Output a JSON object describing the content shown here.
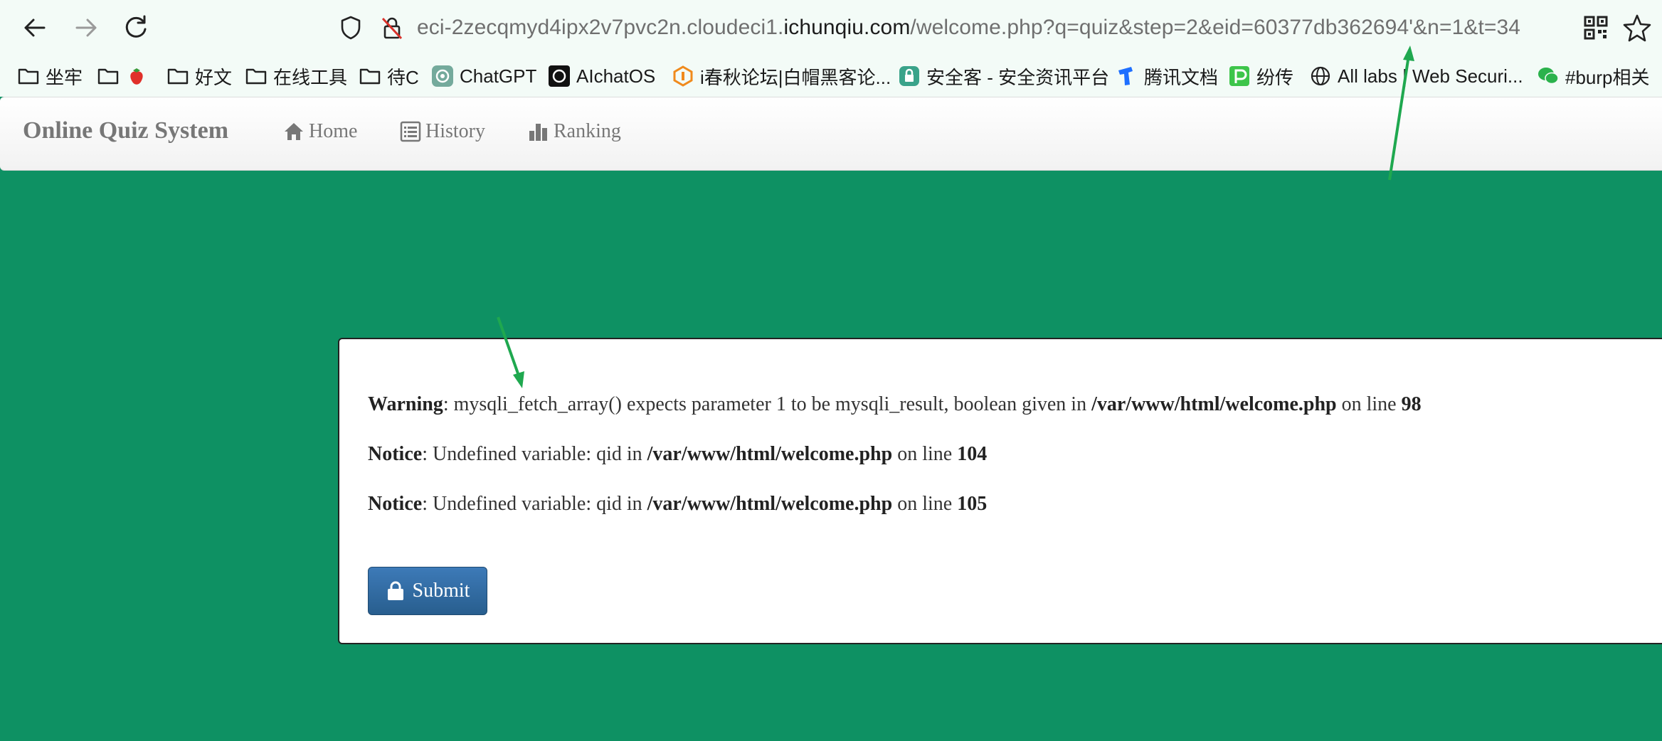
{
  "browser": {
    "url_prefix": "eci-2zecqmyd4ipx2v7pvc2n.cloudeci1.",
    "url_domain": "ichunqiu.com",
    "url_path": "/welcome.php?q=quiz&step=2&eid=60377db362694'&n=1&t=34"
  },
  "bookmarks": [
    {
      "label": "坐牢",
      "icon": "folder-icon"
    },
    {
      "label": "",
      "icon": "folder-strawberry-icon"
    },
    {
      "label": "好文",
      "icon": "folder-icon"
    },
    {
      "label": "在线工具",
      "icon": "folder-icon"
    },
    {
      "label": "待C",
      "icon": "folder-icon"
    },
    {
      "label": "ChatGPT",
      "icon": "chatgpt-icon"
    },
    {
      "label": "AIchatOS",
      "icon": "aichatos-icon"
    },
    {
      "label": "i春秋论坛|白帽黑客论...",
      "icon": "ichunqiu-icon"
    },
    {
      "label": "安全客 - 安全资讯平台",
      "icon": "anquanke-icon"
    },
    {
      "label": "腾讯文档",
      "icon": "tencent-docs-icon"
    },
    {
      "label": "纷传",
      "icon": "fenchuan-icon"
    },
    {
      "label": "All labs | Web Securi...",
      "icon": "globe-icon"
    },
    {
      "label": "#burp相关",
      "icon": "wechat-icon"
    }
  ],
  "nav": {
    "brand": "Online Quiz System",
    "home": "Home",
    "history": "History",
    "ranking": "Ranking"
  },
  "messages": [
    {
      "level": "Warning",
      "text": ": mysqli_fetch_array() expects parameter 1 to be mysqli_result, boolean given in ",
      "file": "/var/www/html/welcome.php",
      "on_line": " on line ",
      "line": "98"
    },
    {
      "level": "Notice",
      "text": ": Undefined variable: qid in ",
      "file": "/var/www/html/welcome.php",
      "on_line": " on line ",
      "line": "104"
    },
    {
      "level": "Notice",
      "text": ": Undefined variable: qid in ",
      "file": "/var/www/html/welcome.php",
      "on_line": " on line ",
      "line": "105"
    }
  ],
  "submit_label": "Submit",
  "colors": {
    "page_bg": "#0e9163",
    "button_bg": "#285e8e",
    "arrow": "#1fa84f"
  }
}
